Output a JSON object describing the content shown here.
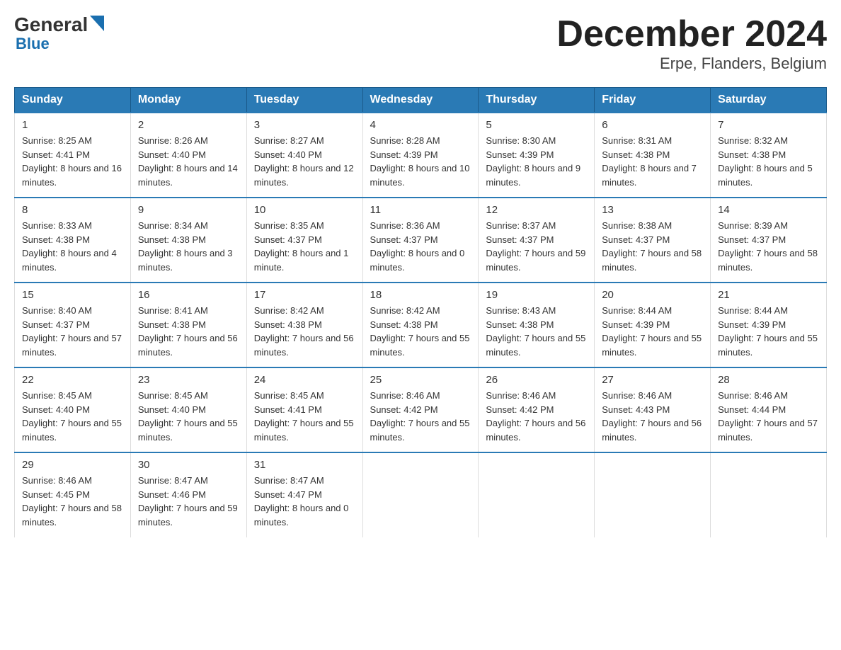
{
  "logo": {
    "part1": "General",
    "part2": "Blue"
  },
  "header": {
    "month": "December 2024",
    "location": "Erpe, Flanders, Belgium"
  },
  "weekdays": [
    "Sunday",
    "Monday",
    "Tuesday",
    "Wednesday",
    "Thursday",
    "Friday",
    "Saturday"
  ],
  "weeks": [
    [
      {
        "day": "1",
        "sunrise": "8:25 AM",
        "sunset": "4:41 PM",
        "daylight": "8 hours and 16 minutes."
      },
      {
        "day": "2",
        "sunrise": "8:26 AM",
        "sunset": "4:40 PM",
        "daylight": "8 hours and 14 minutes."
      },
      {
        "day": "3",
        "sunrise": "8:27 AM",
        "sunset": "4:40 PM",
        "daylight": "8 hours and 12 minutes."
      },
      {
        "day": "4",
        "sunrise": "8:28 AM",
        "sunset": "4:39 PM",
        "daylight": "8 hours and 10 minutes."
      },
      {
        "day": "5",
        "sunrise": "8:30 AM",
        "sunset": "4:39 PM",
        "daylight": "8 hours and 9 minutes."
      },
      {
        "day": "6",
        "sunrise": "8:31 AM",
        "sunset": "4:38 PM",
        "daylight": "8 hours and 7 minutes."
      },
      {
        "day": "7",
        "sunrise": "8:32 AM",
        "sunset": "4:38 PM",
        "daylight": "8 hours and 5 minutes."
      }
    ],
    [
      {
        "day": "8",
        "sunrise": "8:33 AM",
        "sunset": "4:38 PM",
        "daylight": "8 hours and 4 minutes."
      },
      {
        "day": "9",
        "sunrise": "8:34 AM",
        "sunset": "4:38 PM",
        "daylight": "8 hours and 3 minutes."
      },
      {
        "day": "10",
        "sunrise": "8:35 AM",
        "sunset": "4:37 PM",
        "daylight": "8 hours and 1 minute."
      },
      {
        "day": "11",
        "sunrise": "8:36 AM",
        "sunset": "4:37 PM",
        "daylight": "8 hours and 0 minutes."
      },
      {
        "day": "12",
        "sunrise": "8:37 AM",
        "sunset": "4:37 PM",
        "daylight": "7 hours and 59 minutes."
      },
      {
        "day": "13",
        "sunrise": "8:38 AM",
        "sunset": "4:37 PM",
        "daylight": "7 hours and 58 minutes."
      },
      {
        "day": "14",
        "sunrise": "8:39 AM",
        "sunset": "4:37 PM",
        "daylight": "7 hours and 58 minutes."
      }
    ],
    [
      {
        "day": "15",
        "sunrise": "8:40 AM",
        "sunset": "4:37 PM",
        "daylight": "7 hours and 57 minutes."
      },
      {
        "day": "16",
        "sunrise": "8:41 AM",
        "sunset": "4:38 PM",
        "daylight": "7 hours and 56 minutes."
      },
      {
        "day": "17",
        "sunrise": "8:42 AM",
        "sunset": "4:38 PM",
        "daylight": "7 hours and 56 minutes."
      },
      {
        "day": "18",
        "sunrise": "8:42 AM",
        "sunset": "4:38 PM",
        "daylight": "7 hours and 55 minutes."
      },
      {
        "day": "19",
        "sunrise": "8:43 AM",
        "sunset": "4:38 PM",
        "daylight": "7 hours and 55 minutes."
      },
      {
        "day": "20",
        "sunrise": "8:44 AM",
        "sunset": "4:39 PM",
        "daylight": "7 hours and 55 minutes."
      },
      {
        "day": "21",
        "sunrise": "8:44 AM",
        "sunset": "4:39 PM",
        "daylight": "7 hours and 55 minutes."
      }
    ],
    [
      {
        "day": "22",
        "sunrise": "8:45 AM",
        "sunset": "4:40 PM",
        "daylight": "7 hours and 55 minutes."
      },
      {
        "day": "23",
        "sunrise": "8:45 AM",
        "sunset": "4:40 PM",
        "daylight": "7 hours and 55 minutes."
      },
      {
        "day": "24",
        "sunrise": "8:45 AM",
        "sunset": "4:41 PM",
        "daylight": "7 hours and 55 minutes."
      },
      {
        "day": "25",
        "sunrise": "8:46 AM",
        "sunset": "4:42 PM",
        "daylight": "7 hours and 55 minutes."
      },
      {
        "day": "26",
        "sunrise": "8:46 AM",
        "sunset": "4:42 PM",
        "daylight": "7 hours and 56 minutes."
      },
      {
        "day": "27",
        "sunrise": "8:46 AM",
        "sunset": "4:43 PM",
        "daylight": "7 hours and 56 minutes."
      },
      {
        "day": "28",
        "sunrise": "8:46 AM",
        "sunset": "4:44 PM",
        "daylight": "7 hours and 57 minutes."
      }
    ],
    [
      {
        "day": "29",
        "sunrise": "8:46 AM",
        "sunset": "4:45 PM",
        "daylight": "7 hours and 58 minutes."
      },
      {
        "day": "30",
        "sunrise": "8:47 AM",
        "sunset": "4:46 PM",
        "daylight": "7 hours and 59 minutes."
      },
      {
        "day": "31",
        "sunrise": "8:47 AM",
        "sunset": "4:47 PM",
        "daylight": "8 hours and 0 minutes."
      },
      null,
      null,
      null,
      null
    ]
  ]
}
